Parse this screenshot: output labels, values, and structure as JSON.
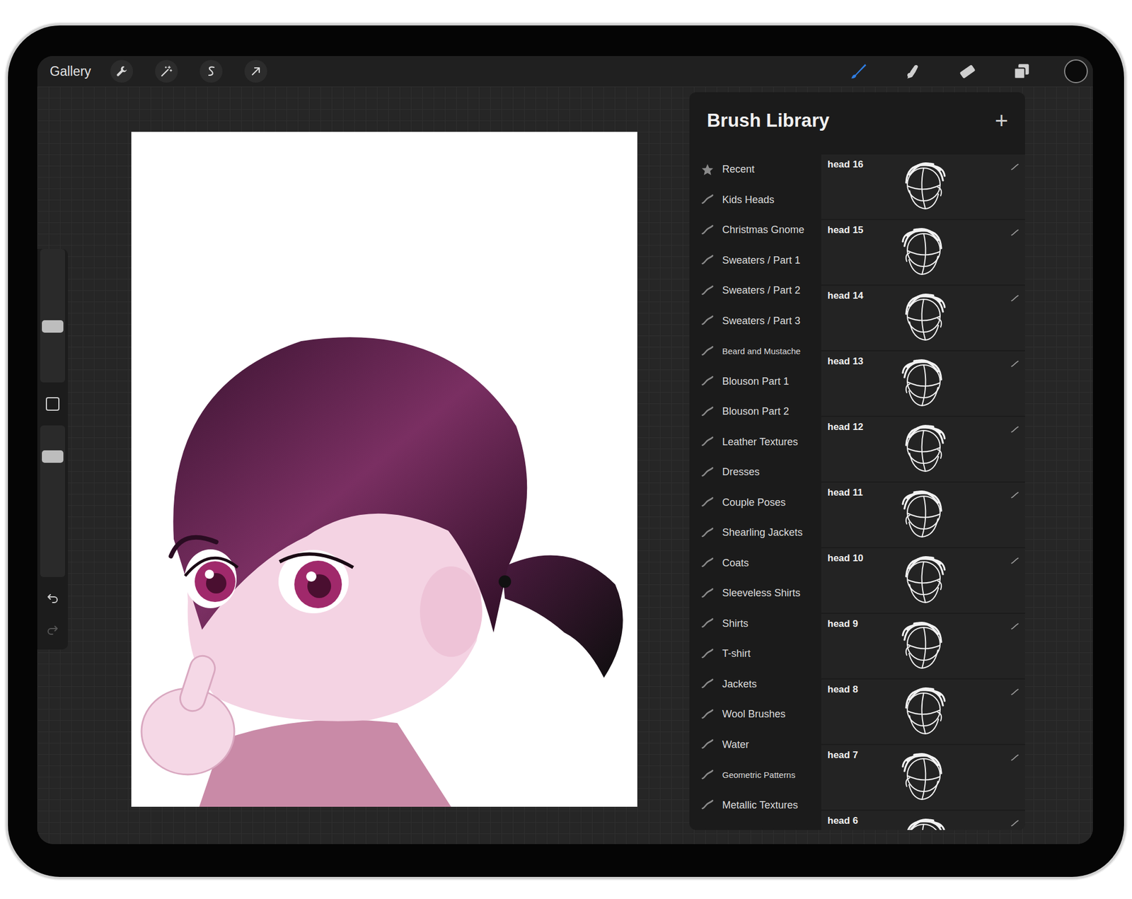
{
  "toolbar": {
    "gallery": "Gallery",
    "left_tools": [
      {
        "kind": "wrench"
      },
      {
        "kind": "wand"
      },
      {
        "kind": "selection"
      },
      {
        "kind": "transform"
      }
    ],
    "right_tools": [
      {
        "kind": "brush",
        "selected": true
      },
      {
        "kind": "smudge",
        "selected": false
      },
      {
        "kind": "eraser",
        "selected": false
      },
      {
        "kind": "layers",
        "selected": false
      },
      {
        "kind": "color",
        "selected": false
      }
    ]
  },
  "sidebar": {
    "sliders": [
      {
        "level": 0.41
      },
      {
        "level": 0.82
      }
    ]
  },
  "brush_library": {
    "title": "Brush Library",
    "add": "+",
    "categories": [
      {
        "label": "Recent",
        "kind": "recent"
      },
      {
        "label": "Kids Heads",
        "kind": "set"
      },
      {
        "label": "Christmas Gnome",
        "kind": "set"
      },
      {
        "label": "Sweaters / Part 1",
        "kind": "set"
      },
      {
        "label": "Sweaters / Part 2",
        "kind": "set"
      },
      {
        "label": "Sweaters / Part 3",
        "kind": "set"
      },
      {
        "label": "Beard and Mustache",
        "kind": "set"
      },
      {
        "label": "Blouson Part 1",
        "kind": "set"
      },
      {
        "label": "Blouson Part 2",
        "kind": "set"
      },
      {
        "label": "Leather Textures",
        "kind": "set"
      },
      {
        "label": "Dresses",
        "kind": "set"
      },
      {
        "label": "Couple Poses",
        "kind": "set"
      },
      {
        "label": "Shearling Jackets",
        "kind": "set"
      },
      {
        "label": "Coats",
        "kind": "set"
      },
      {
        "label": "Sleeveless Shirts",
        "kind": "set"
      },
      {
        "label": "Shirts",
        "kind": "set"
      },
      {
        "label": "T-shirt",
        "kind": "set"
      },
      {
        "label": "Jackets",
        "kind": "set"
      },
      {
        "label": "Wool Brushes",
        "kind": "set"
      },
      {
        "label": "Water",
        "kind": "set"
      },
      {
        "label": "Geometric Patterns",
        "kind": "set"
      },
      {
        "label": "Metallic Textures",
        "kind": "set"
      }
    ],
    "brushes": [
      {
        "label": "head 16"
      },
      {
        "label": "head 15"
      },
      {
        "label": "head 14"
      },
      {
        "label": "head 13"
      },
      {
        "label": "head 12"
      },
      {
        "label": "head 11"
      },
      {
        "label": "head 10"
      },
      {
        "label": "head 9"
      },
      {
        "label": "head 8"
      },
      {
        "label": "head 7"
      },
      {
        "label": "head 6"
      }
    ]
  }
}
